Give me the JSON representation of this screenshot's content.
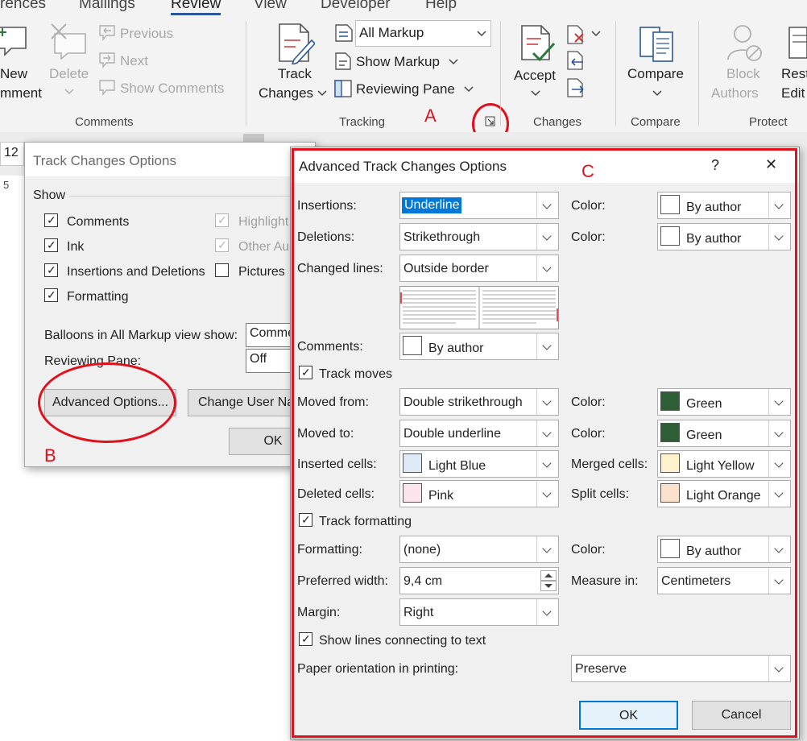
{
  "ribbon": {
    "tabs": [
      "rences",
      "Mailings",
      "Review",
      "View",
      "Developer",
      "Help"
    ],
    "comments": {
      "new_comment_1": "New",
      "new_comment_2": "mment",
      "delete": "Delete",
      "previous": "Previous",
      "next": "Next",
      "show_comments": "Show Comments",
      "group": "Comments"
    },
    "tracking": {
      "track_changes_1": "Track",
      "track_changes_2": "Changes",
      "markup_select": "All Markup",
      "show_markup": "Show Markup",
      "reviewing_pane": "Reviewing Pane",
      "group": "Tracking"
    },
    "changes": {
      "accept": "Accept",
      "group": "Changes"
    },
    "compare": {
      "compare": "Compare",
      "group": "Compare"
    },
    "protect": {
      "block_1": "Block",
      "block_2": "Authors",
      "restrict_1": "Rest",
      "restrict_2": "Edit",
      "group": "Protect"
    }
  },
  "document": {
    "font_size": "12",
    "ruler_number": "5"
  },
  "annotations": {
    "a": "A",
    "b": "B",
    "c": "C"
  },
  "dialog_main": {
    "title": "Track Changes Options",
    "show_label": "Show",
    "comments": "Comments",
    "ink": "Ink",
    "insertions_deletions": "Insertions and Deletions",
    "formatting": "Formatting",
    "highlight": "Highlight",
    "other_authors": "Other Au",
    "pictures": "Pictures",
    "balloons_label": "Balloons in All Markup view show:",
    "balloons_value": "Comme",
    "reviewing_pane_label": "Reviewing Pane:",
    "reviewing_pane_value": "Off",
    "advanced_button": "Advanced Options...",
    "change_user_button": "Change User Na",
    "ok_button": "OK"
  },
  "dialog_adv": {
    "title": "Advanced Track Changes Options",
    "help": "?",
    "close": "✕",
    "insertions_label": "Insertions:",
    "insertions_value": "Underline",
    "insertions_color_label": "Color:",
    "insertions_color_value": "By author",
    "deletions_label": "Deletions:",
    "deletions_value": "Strikethrough",
    "deletions_color_label": "Color:",
    "deletions_color_value": "By author",
    "changed_lines_label": "Changed lines:",
    "changed_lines_value": "Outside border",
    "comments_label": "Comments:",
    "comments_value": "By author",
    "track_moves": "Track moves",
    "moved_from_label": "Moved from:",
    "moved_from_value": "Double strikethrough",
    "moved_from_color_label": "Color:",
    "moved_from_color_value": "Green",
    "moved_to_label": "Moved to:",
    "moved_to_value": "Double underline",
    "moved_to_color_label": "Color:",
    "moved_to_color_value": "Green",
    "inserted_cells_label": "Inserted cells:",
    "inserted_cells_value": "Light Blue",
    "merged_cells_label": "Merged cells:",
    "merged_cells_value": "Light Yellow",
    "deleted_cells_label": "Deleted cells:",
    "deleted_cells_value": "Pink",
    "split_cells_label": "Split cells:",
    "split_cells_value": "Light Orange",
    "track_formatting": "Track formatting",
    "formatting_label": "Formatting:",
    "formatting_value": "(none)",
    "formatting_color_label": "Color:",
    "formatting_color_value": "By author",
    "preferred_width_label": "Preferred width:",
    "preferred_width_value": "9,4 cm",
    "measure_label": "Measure in:",
    "measure_value": "Centimeters",
    "margin_label": "Margin:",
    "margin_value": "Right",
    "show_lines": "Show lines connecting to text",
    "paper_orientation_label": "Paper orientation in printing:",
    "paper_orientation_value": "Preserve",
    "ok_button": "OK",
    "cancel_button": "Cancel"
  },
  "colors": {
    "annotation": "#e0111c",
    "green": "#2e5e35",
    "light_blue": "#deebf7",
    "light_yellow": "#fff2cc",
    "pink": "#fce4ec",
    "light_orange": "#fbe1cc",
    "selection": "#0078d7"
  }
}
